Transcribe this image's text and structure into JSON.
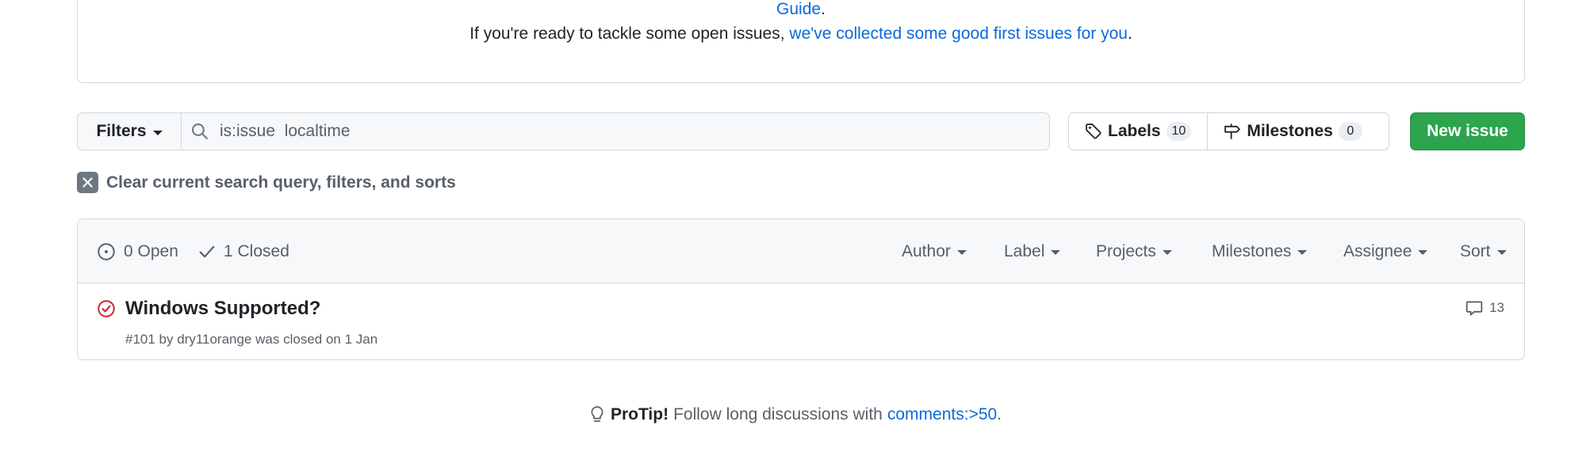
{
  "notice": {
    "line1_link": "Guide",
    "line1_suffix": ".",
    "line2_text": "If you're ready to tackle some open issues, ",
    "line2_link": "we've collected some good first issues for you",
    "line2_suffix": "."
  },
  "toolbar": {
    "filters_label": "Filters",
    "search_value": "is:issue  localtime",
    "labels_label": "Labels",
    "labels_count": "10",
    "milestones_label": "Milestones",
    "milestones_count": "0",
    "new_issue_label": "New issue"
  },
  "clear": {
    "label": "Clear current search query, filters, and sorts"
  },
  "issues_header": {
    "open_label": "0 Open",
    "closed_label": "1 Closed",
    "filters": [
      "Author",
      "Label",
      "Projects",
      "Milestones",
      "Assignee",
      "Sort"
    ]
  },
  "issues": [
    {
      "title": "Windows Supported?",
      "meta": "#101 by dry11orange was closed on 1 Jan",
      "comments": "13"
    }
  ],
  "protip": {
    "bold": "ProTip!",
    "text": "Follow long discussions with",
    "link": "comments:>50",
    "suffix": "."
  },
  "colors": {
    "accent_link": "#0969da",
    "primary_button": "#2da44e",
    "closed_icon": "#cf222e",
    "border": "#d0d7de"
  }
}
